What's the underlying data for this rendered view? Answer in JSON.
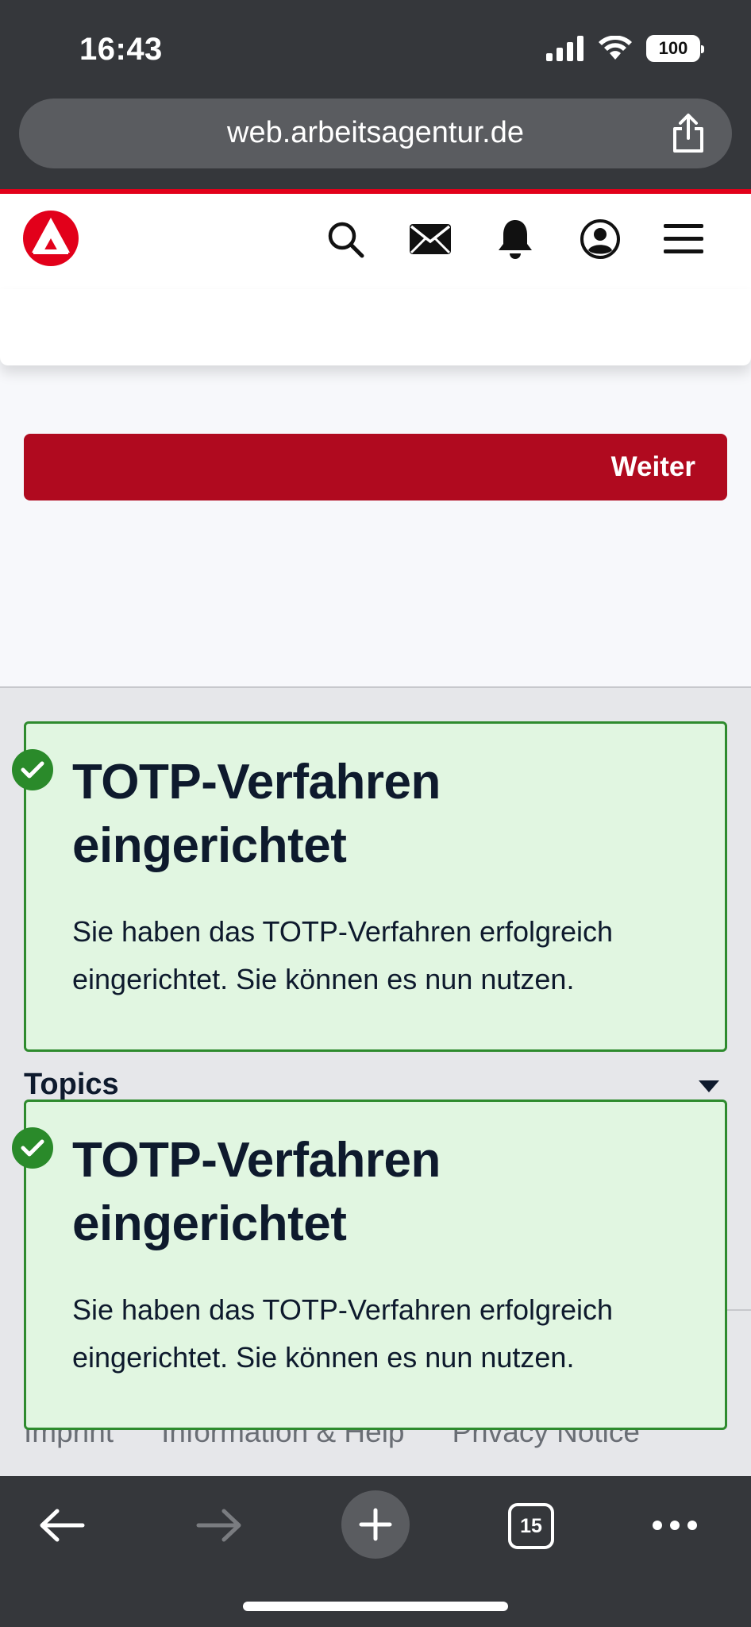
{
  "status_bar": {
    "time": "16:43",
    "battery": "100"
  },
  "browser": {
    "url": "web.arbeitsagentur.de",
    "tab_count": "15"
  },
  "header": {
    "icons": [
      "search-icon",
      "mail-icon",
      "bell-icon",
      "account-icon",
      "menu-icon"
    ]
  },
  "main": {
    "weiter_label": "Weiter"
  },
  "footer": {
    "topics_label": "Topics",
    "links": [
      "Imprint",
      "Information & Help",
      "Privacy Notice"
    ]
  },
  "toasts": [
    {
      "title": "TOTP-Verfahren eingerichtet",
      "body": "Sie haben das TOTP-Verfahren erfolgreich eingerichtet. Sie können es nun nutzen."
    },
    {
      "title": "TOTP-Verfahren eingerichtet",
      "body": "Sie haben das TOTP-Verfahren erfolgreich eingerichtet. Sie können es nun nutzen."
    }
  ],
  "colors": {
    "brand_red": "#e2001a",
    "button_red": "#b00a1f",
    "success_green": "#2a8a2a",
    "toast_bg": "#e1f6e1"
  }
}
